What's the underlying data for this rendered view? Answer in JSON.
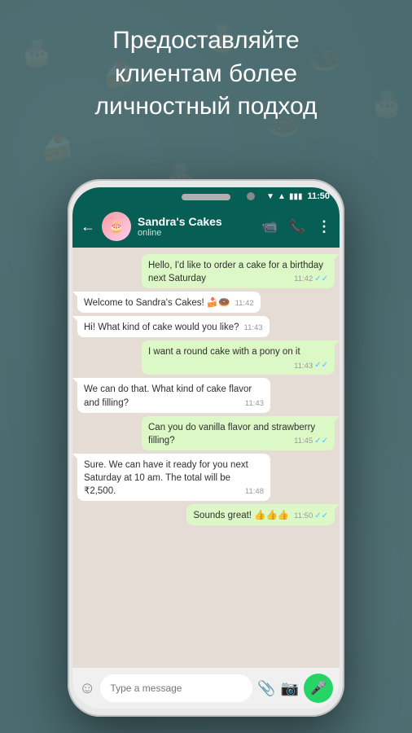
{
  "headline": {
    "line1": "Предоставляйте",
    "line2": "клиентам более",
    "line3": "личностный подход"
  },
  "status_bar": {
    "time": "11:50",
    "signal_icon": "▼",
    "wifi_icon": "▲",
    "battery_icon": "▮"
  },
  "chat_header": {
    "back_label": "←",
    "contact_name": "Sandra's Cakes",
    "contact_status": "online",
    "avatar_emoji": "🎂",
    "video_icon": "📹",
    "phone_icon": "📞",
    "more_icon": "⋮"
  },
  "messages": [
    {
      "id": 1,
      "type": "outgoing",
      "text": "Hello, I'd like to order a cake for a birthday next Saturday",
      "time": "11:42",
      "ticks": "✓✓",
      "ticks_color": "blue"
    },
    {
      "id": 2,
      "type": "incoming",
      "text": "Welcome to Sandra's Cakes! 🍰🍩",
      "time": "11:42",
      "ticks": null
    },
    {
      "id": 3,
      "type": "incoming",
      "text": "Hi! What kind of cake would you like?",
      "time": "11:43",
      "ticks": null
    },
    {
      "id": 4,
      "type": "outgoing",
      "text": "I want a round cake with a pony on it",
      "time": "11:43",
      "ticks": "✓✓",
      "ticks_color": "blue"
    },
    {
      "id": 5,
      "type": "incoming",
      "text": "We can do that. What kind of cake flavor and filling?",
      "time": "11:43",
      "ticks": null
    },
    {
      "id": 6,
      "type": "outgoing",
      "text": "Can you do vanilla flavor and strawberry filling?",
      "time": "11:45",
      "ticks": "✓✓",
      "ticks_color": "blue"
    },
    {
      "id": 7,
      "type": "incoming",
      "text": "Sure. We can have it ready for you next Saturday at 10 am. The total will be ₹2,500.",
      "time": "11:48",
      "ticks": null
    },
    {
      "id": 8,
      "type": "outgoing",
      "text": "Sounds great! 👍👍👍",
      "time": "11:50",
      "ticks": "✓✓",
      "ticks_color": "blue"
    }
  ],
  "input": {
    "placeholder": "Type a message"
  }
}
